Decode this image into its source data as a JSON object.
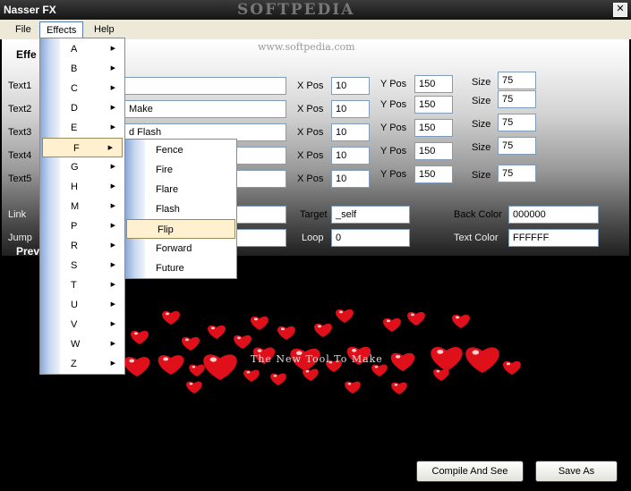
{
  "window": {
    "title": "Nasser FX",
    "close_symbol": "✕"
  },
  "watermark": {
    "brand": "SOFTPEDIA",
    "url": "www.softpedia.com"
  },
  "menubar": [
    {
      "label": "File",
      "open": false
    },
    {
      "label": "Effects",
      "open": true
    },
    {
      "label": "Help",
      "open": false
    }
  ],
  "form": {
    "section_title": "Effe",
    "rows": [
      {
        "label": "Text1",
        "text": "",
        "xpos_label": "X Pos",
        "xpos": "10",
        "ypos_label": "Y Pos",
        "ypos": "150",
        "size_label": "Size",
        "size": "75"
      },
      {
        "label": "Text2",
        "text": "Make",
        "xpos_label": "X Pos",
        "xpos": "10",
        "ypos_label": "Y Pos",
        "ypos": "150",
        "size_label": "Size",
        "size": "75"
      },
      {
        "label": "Text3",
        "text": "d Flash",
        "xpos_label": "X Pos",
        "xpos": "10",
        "ypos_label": "Y Pos",
        "ypos": "150",
        "size_label": "Size",
        "size": "75"
      },
      {
        "label": "Text4",
        "text": "",
        "xpos_label": "X Pos",
        "xpos": "10",
        "ypos_label": "Y Pos",
        "ypos": "150",
        "size_label": "Size",
        "size": "75"
      },
      {
        "label": "Text5",
        "text": "",
        "xpos_label": "X Pos",
        "xpos": "10",
        "ypos_label": "Y Pos",
        "ypos": "150",
        "size_label": "Size",
        "size": "75"
      }
    ],
    "link": {
      "label": "Link",
      "value": ""
    },
    "target": {
      "label": "Target",
      "value": "_self"
    },
    "back_color": {
      "label": "Back Color",
      "value": "000000"
    },
    "jump": {
      "label": "Jump",
      "value": ""
    },
    "loop": {
      "label": "Loop",
      "value": "0"
    },
    "text_color": {
      "label": "Text Color",
      "value": "FFFFFF"
    }
  },
  "preview": {
    "label": "Prev",
    "credit": "The New Tool To Make",
    "heart_color": "#e0101a"
  },
  "buttons": {
    "compile": "Compile And See",
    "save_as": "Save As"
  },
  "effects_menu": [
    "A",
    "B",
    "C",
    "D",
    "E",
    "F",
    "G",
    "H",
    "M",
    "P",
    "R",
    "S",
    "T",
    "U",
    "V",
    "W",
    "Z"
  ],
  "effects_menu_selected": "F",
  "submenu_f": [
    "Fence",
    "Fire",
    "Flare",
    "Flash",
    "Flip",
    "Forward",
    "Future"
  ],
  "submenu_f_selected": "Flip"
}
